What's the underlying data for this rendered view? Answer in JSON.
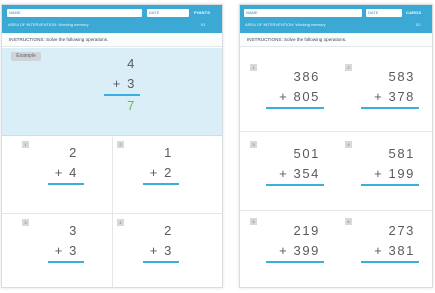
{
  "left": {
    "header": {
      "name_label": "NAME",
      "date_label": "DATE",
      "points_label": "POINTS",
      "aoi": "AREA OF INTERVENTION: Working memory",
      "page": "01"
    },
    "instructions": "INSTRUCTIONS: Solve the following operations.",
    "example": {
      "tag": "Example",
      "top": "4",
      "bottom": "+ 3",
      "answer": "7"
    },
    "problems": [
      {
        "num": "1",
        "top": "2",
        "bottom": "+ 4"
      },
      {
        "num": "2",
        "top": "1",
        "bottom": "+ 2"
      },
      {
        "num": "3",
        "top": "3",
        "bottom": "+ 3"
      },
      {
        "num": "4",
        "top": "2",
        "bottom": "+ 3"
      }
    ]
  },
  "right": {
    "header": {
      "name_label": "NAME",
      "date_label": "DATE",
      "points_label": "CARDS",
      "aoi": "AREA OF INTERVENTION: Working memory",
      "page": "02"
    },
    "instructions": "INSTRUCTIONS: Solve the following operations.",
    "problems": [
      {
        "num": "1",
        "top": "386",
        "bottom": "+ 805"
      },
      {
        "num": "2",
        "top": "583",
        "bottom": "+ 378"
      },
      {
        "num": "3",
        "top": "501",
        "bottom": "+ 354"
      },
      {
        "num": "4",
        "top": "581",
        "bottom": "+ 199"
      },
      {
        "num": "5",
        "top": "219",
        "bottom": "+ 399"
      },
      {
        "num": "6",
        "top": "273",
        "bottom": "+ 381"
      }
    ]
  },
  "colors": {
    "header_blue": "#3ca8d4",
    "example_bg": "#daeef7",
    "rule_blue": "#3aaee0",
    "answer_green": "#6dba3a"
  }
}
